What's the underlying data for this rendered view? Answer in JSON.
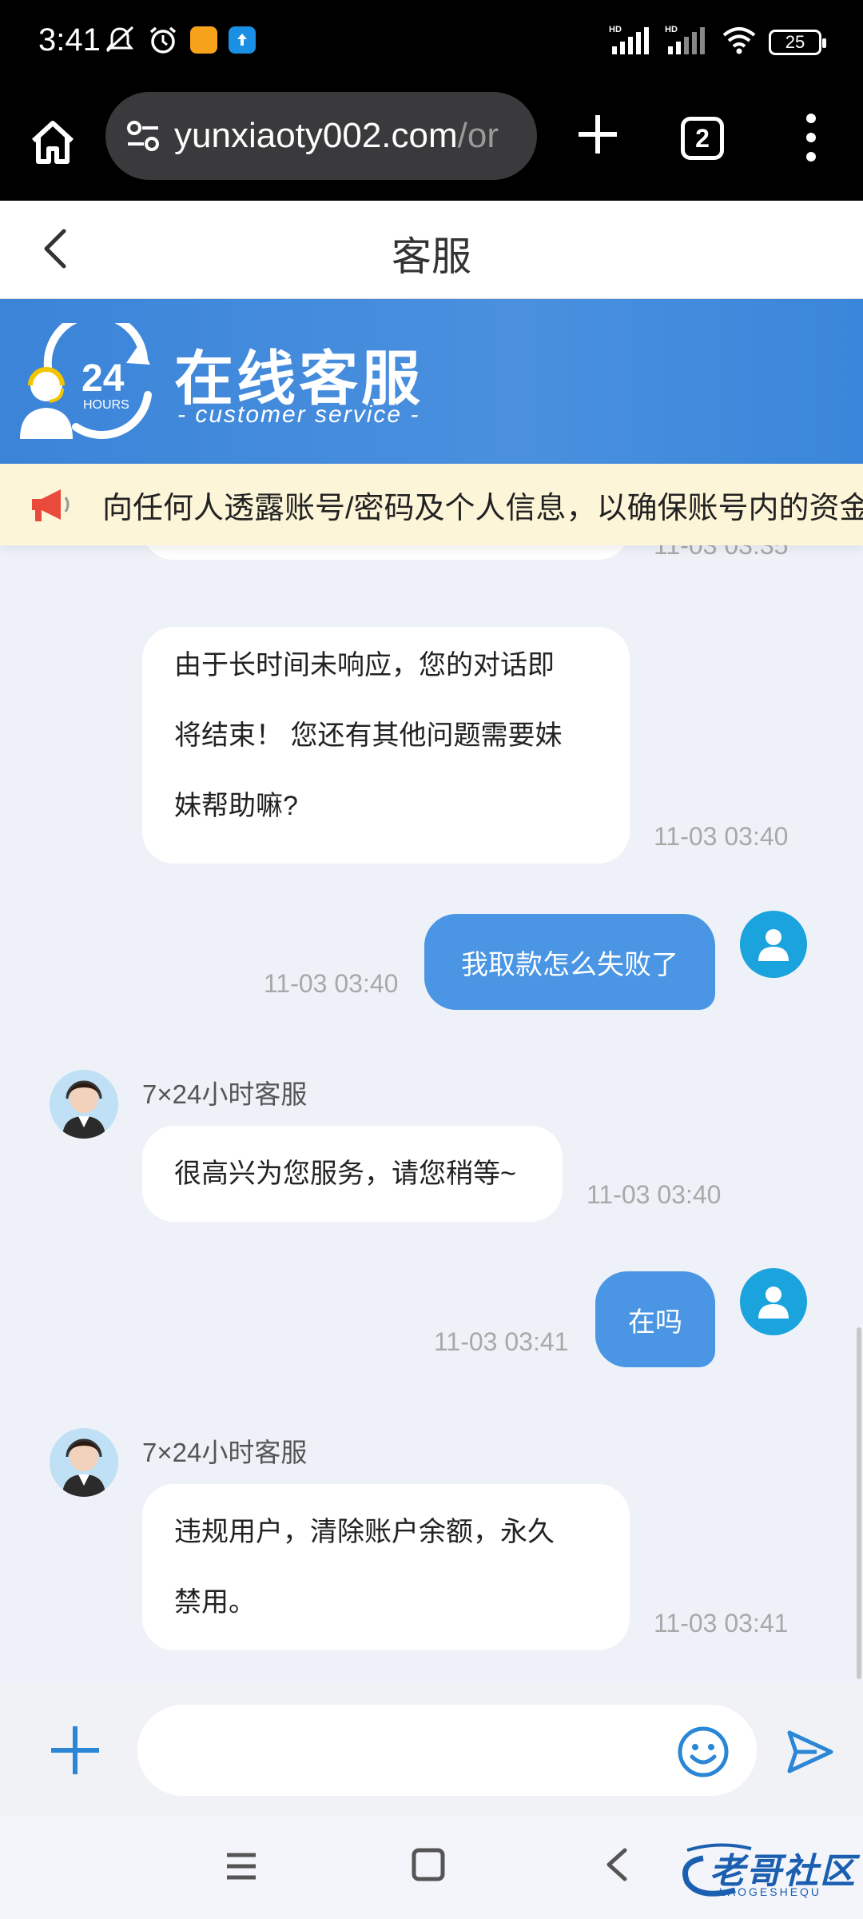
{
  "status_bar": {
    "time": "3:41",
    "battery": "25",
    "signal1_label": "HD",
    "signal2_label": "HD"
  },
  "browser": {
    "url_main": "yunxiaoty002.com",
    "url_rest": "/or",
    "tab_count": "2"
  },
  "header": {
    "title": "客服"
  },
  "banner": {
    "badge_number": "24",
    "badge_label": "HOURS",
    "title": "在线客服",
    "subtitle": "- customer service -"
  },
  "notice": {
    "text": "向任何人透露账号/密码及个人信息，以确保账号内的资金"
  },
  "messages": [
    {
      "timestamp": "11-03 03:35"
    },
    {
      "text": "由于长时间未响应，您的对话即将结束！ 您还有其他问题需要妹妹帮助嘛?",
      "line1": "由于长时间未响应，您的对话即",
      "line2": "将结束！ 您还有其他问题需要妹",
      "line3": "妹帮助嘛?",
      "timestamp": "11-03 03:40"
    },
    {
      "text": "我取款怎么失败了",
      "timestamp": "11-03 03:40"
    },
    {
      "sender": "7×24小时客服",
      "text": "很高兴为您服务，请您稍等~",
      "timestamp": "11-03 03:40"
    },
    {
      "text": "在吗",
      "timestamp": "11-03 03:41"
    },
    {
      "sender": "7×24小时客服",
      "line1": "违规用户，清除账户余额，永久",
      "line2": "禁用。",
      "timestamp": "11-03 03:41"
    }
  ],
  "input": {
    "placeholder": ""
  },
  "watermark": {
    "text": "老哥社区",
    "sub": "LAOGESHEQU"
  },
  "colors": {
    "accent": "#4a96e4",
    "banner": "#3b84d8",
    "notice_bg": "#fdf5d8"
  }
}
